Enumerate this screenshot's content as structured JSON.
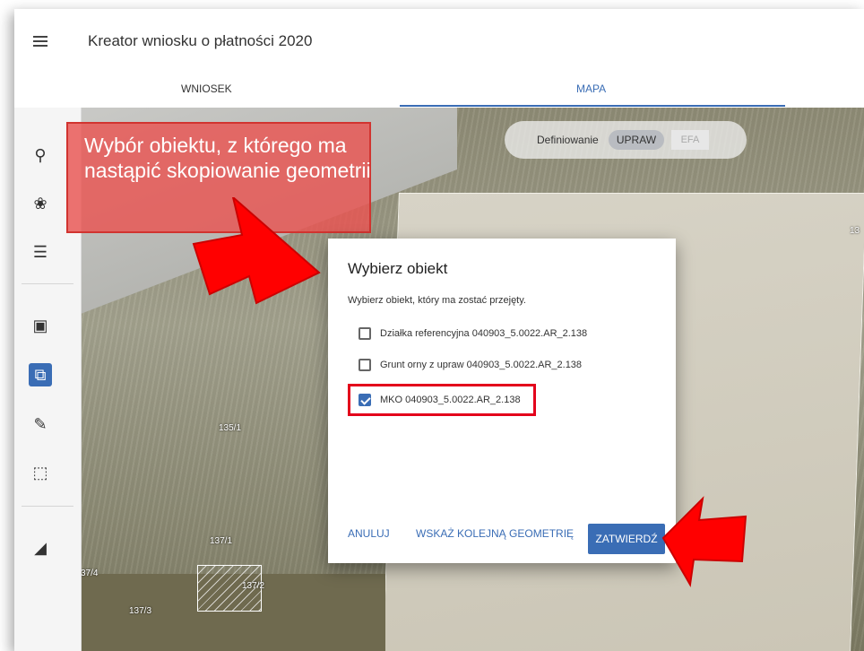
{
  "header": {
    "title": "Kreator wniosku o płatności 2020",
    "menu_icon": "hamburger-icon"
  },
  "tabs": [
    {
      "label": "WNIOSEK"
    },
    {
      "label": "MAPA",
      "active": true
    }
  ],
  "map": {
    "toggle": {
      "label": "Definiowanie",
      "options": [
        "UPRAW",
        "EFA"
      ],
      "selected": "UPRAW"
    },
    "plot_labels": [
      "135/1",
      "137/1",
      "137/2",
      "137/3",
      "37/4",
      "13"
    ]
  },
  "toolbar": {
    "tools": [
      "search-icon",
      "layers-icon",
      "list-icon",
      "select-area-icon",
      "copy-geometry-icon",
      "pencil-icon",
      "crop-icon",
      "ruler-icon"
    ],
    "active": "copy-geometry-icon"
  },
  "callout": {
    "text": "Wybór obiektu, z którego ma nastąpić skopiowanie geometrii"
  },
  "dialog": {
    "title": "Wybierz obiekt",
    "subtitle": "Wybierz obiekt, który ma zostać przejęty.",
    "options": [
      {
        "label": "Działka referencyjna 040903_5.0022.AR_2.138",
        "checked": false
      },
      {
        "label": "Grunt orny z upraw 040903_5.0022.AR_2.138",
        "checked": false
      },
      {
        "label": "MKO 040903_5.0022.AR_2.138",
        "checked": true
      }
    ],
    "buttons": {
      "cancel": "ANULUJ",
      "next": "WSKAŻ KOLEJNĄ GEOMETRIĘ",
      "confirm": "ZATWIERDŹ"
    }
  },
  "colors": {
    "accent": "#3a6db5",
    "annotation": "#e3001b"
  }
}
